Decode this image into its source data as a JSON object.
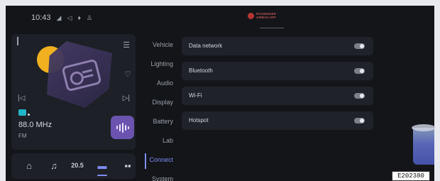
{
  "status_bar": {
    "time": "10:43",
    "icons": [
      "signal-icon",
      "location-icon",
      "microphone-icon",
      "person-icon"
    ]
  },
  "airbag": {
    "line1": "PASSENGER",
    "line2": "AIRBAG OFF",
    "color": "#b53434"
  },
  "media": {
    "frequency": "88.0 MHz",
    "band": "FM",
    "icons": [
      "playlist-icon",
      "heart-icon",
      "previous-icon",
      "next-icon",
      "voice-icon",
      "radio-icon"
    ]
  },
  "dock": {
    "items": [
      {
        "name": "home",
        "glyph": "⌂"
      },
      {
        "name": "music",
        "glyph": "♫"
      },
      {
        "name": "climate",
        "glyph": "20.5"
      },
      {
        "name": "car",
        "glyph": "▬"
      },
      {
        "name": "apps",
        "glyph": "▪▪"
      }
    ],
    "active": "car"
  },
  "nav": {
    "items": [
      "Vehicle",
      "Lighting",
      "Audio",
      "Display",
      "Battery",
      "Lab",
      "Connect",
      "System"
    ],
    "active": "Connect"
  },
  "settings": [
    {
      "label": "Data network",
      "on": false
    },
    {
      "label": "Bluetooth",
      "on": false
    },
    {
      "label": "Wi-Fi",
      "on": false
    },
    {
      "label": "Hotspot",
      "on": false
    }
  ],
  "stamp": "E202380",
  "colors": {
    "accent": "#7d8cf5",
    "background": "#131519",
    "card": "#1d2026",
    "voice_button": "#6b54b0",
    "sun": "#f0b020"
  }
}
